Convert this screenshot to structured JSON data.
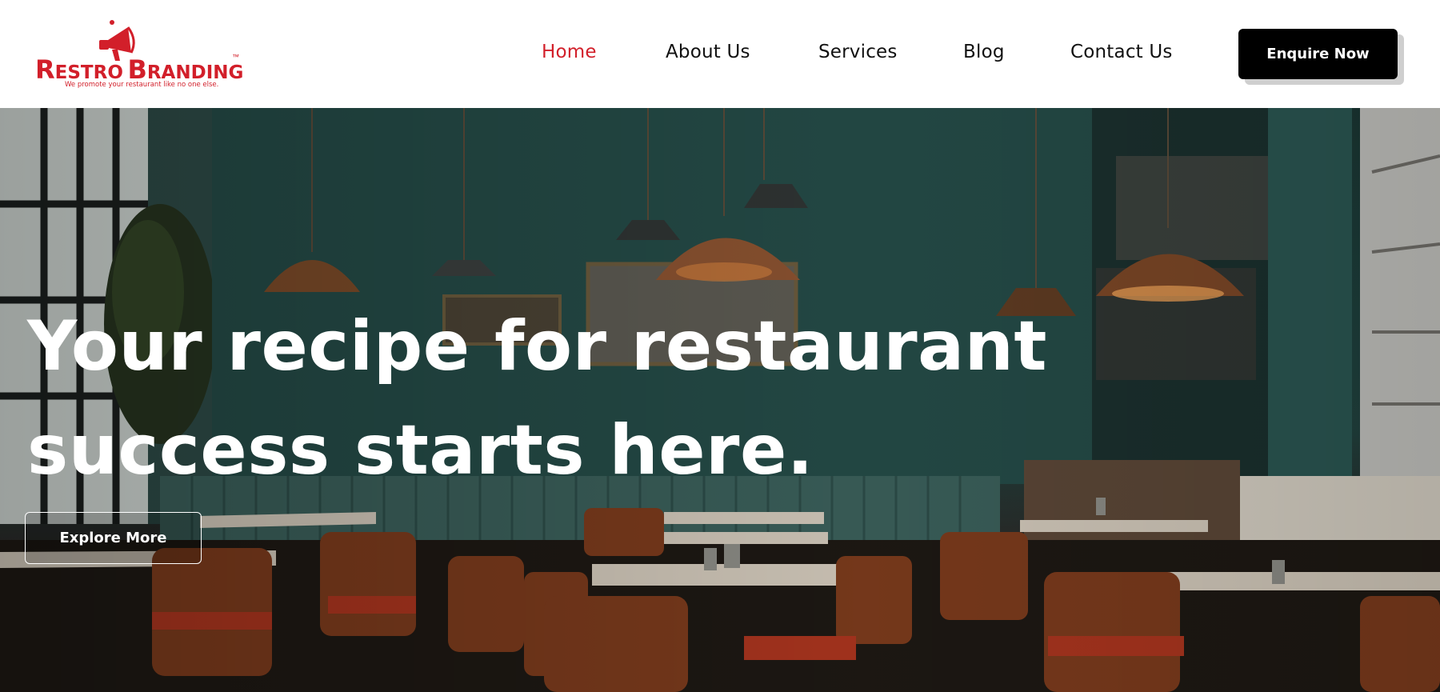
{
  "brand": {
    "name_part1_initial": "R",
    "name_part1_rest": "ESTRO",
    "name_part2_initial": "B",
    "name_part2_rest": "RANDING",
    "trademark": "™",
    "tagline": "We promote your restaurant like no one else.",
    "logo_icon": "megaphone-icon",
    "color": "#d21f2a"
  },
  "nav": {
    "items": [
      {
        "label": "Home",
        "active": true
      },
      {
        "label": "About Us",
        "active": false
      },
      {
        "label": "Services",
        "active": false
      },
      {
        "label": "Blog",
        "active": false
      },
      {
        "label": "Contact Us",
        "active": false
      }
    ],
    "active_color": "#d21f2a",
    "cta_label": "Enquire Now"
  },
  "hero": {
    "title_line1": "Your recipe for restaurant",
    "title_line2": "success starts here.",
    "button_label": "Explore More"
  }
}
